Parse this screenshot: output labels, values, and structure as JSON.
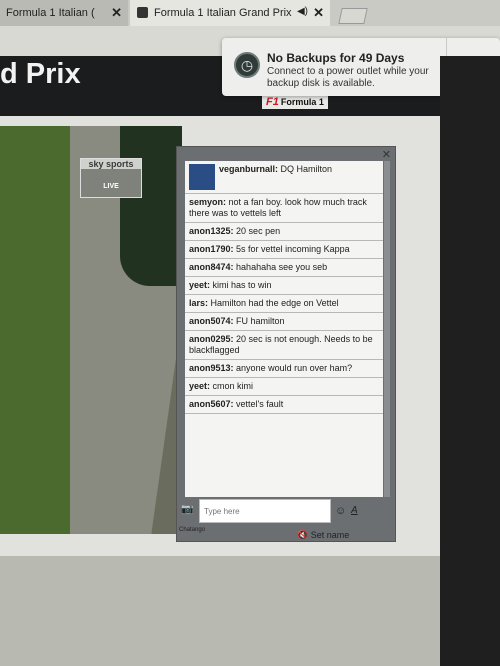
{
  "tabs": [
    {
      "label": "Formula 1 Italian (",
      "active": false
    },
    {
      "label": "Formula 1 Italian Grand Prix",
      "active": true
    }
  ],
  "page": {
    "title": "d Prix",
    "logo_text": "Formula 1"
  },
  "notification": {
    "title": "No Backups for 49 Days",
    "body": "Connect to a power outlet while your backup disk is available.",
    "close_label": "Close"
  },
  "stream": {
    "overlay_brand": "sky sports",
    "overlay_live": "LIVE"
  },
  "chat": {
    "messages": [
      {
        "user": "veganburnall:",
        "text": "DQ Hamilton",
        "avatar": true
      },
      {
        "user": "semyon:",
        "text": "not a fan boy. look how much track there was to vettels left"
      },
      {
        "user": "anon1325:",
        "text": "20 sec pen"
      },
      {
        "user": "anon1790:",
        "text": "5s for vettel incoming Kappa"
      },
      {
        "user": "anon8474:",
        "text": "hahahaha see you seb"
      },
      {
        "user": "yeet:",
        "text": "kimi has to win"
      },
      {
        "user": "lars:",
        "text": "Hamilton had the edge on Vettel"
      },
      {
        "user": "anon5074:",
        "text": "FU hamilton"
      },
      {
        "user": "anon0295:",
        "text": "20 sec is not enough. Needs to be blackflagged"
      },
      {
        "user": "anon9513:",
        "text": "anyone would run over ham?"
      },
      {
        "user": "yeet:",
        "text": "cmon kimi"
      },
      {
        "user": "anon5607:",
        "text": "vettel's fault"
      }
    ],
    "input_placeholder": "Type here",
    "brand": "Chatango",
    "set_name_label": "Set name"
  }
}
